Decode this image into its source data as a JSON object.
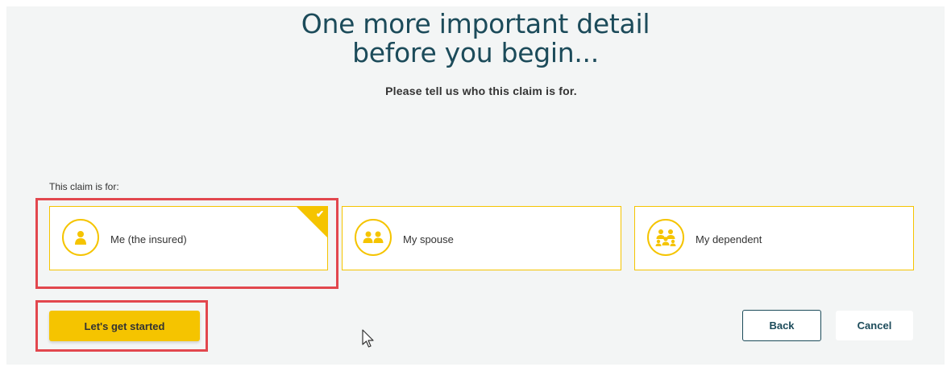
{
  "heading": {
    "line1": "One more important detail",
    "line2": "before you begin..."
  },
  "subheading": "Please tell us who this claim is for.",
  "claim_label": "This claim is for:",
  "options": [
    {
      "label": "Me (the insured)",
      "icon": "person-icon",
      "selected": true
    },
    {
      "label": "My spouse",
      "icon": "couple-icon",
      "selected": false
    },
    {
      "label": "My dependent",
      "icon": "family-icon",
      "selected": false
    }
  ],
  "buttons": {
    "start": "Let's get started",
    "back": "Back",
    "cancel": "Cancel"
  },
  "colors": {
    "accent": "#f5c400",
    "heading": "#1c4b5a",
    "highlight": "#e2474e",
    "background": "#f3f5f5"
  }
}
